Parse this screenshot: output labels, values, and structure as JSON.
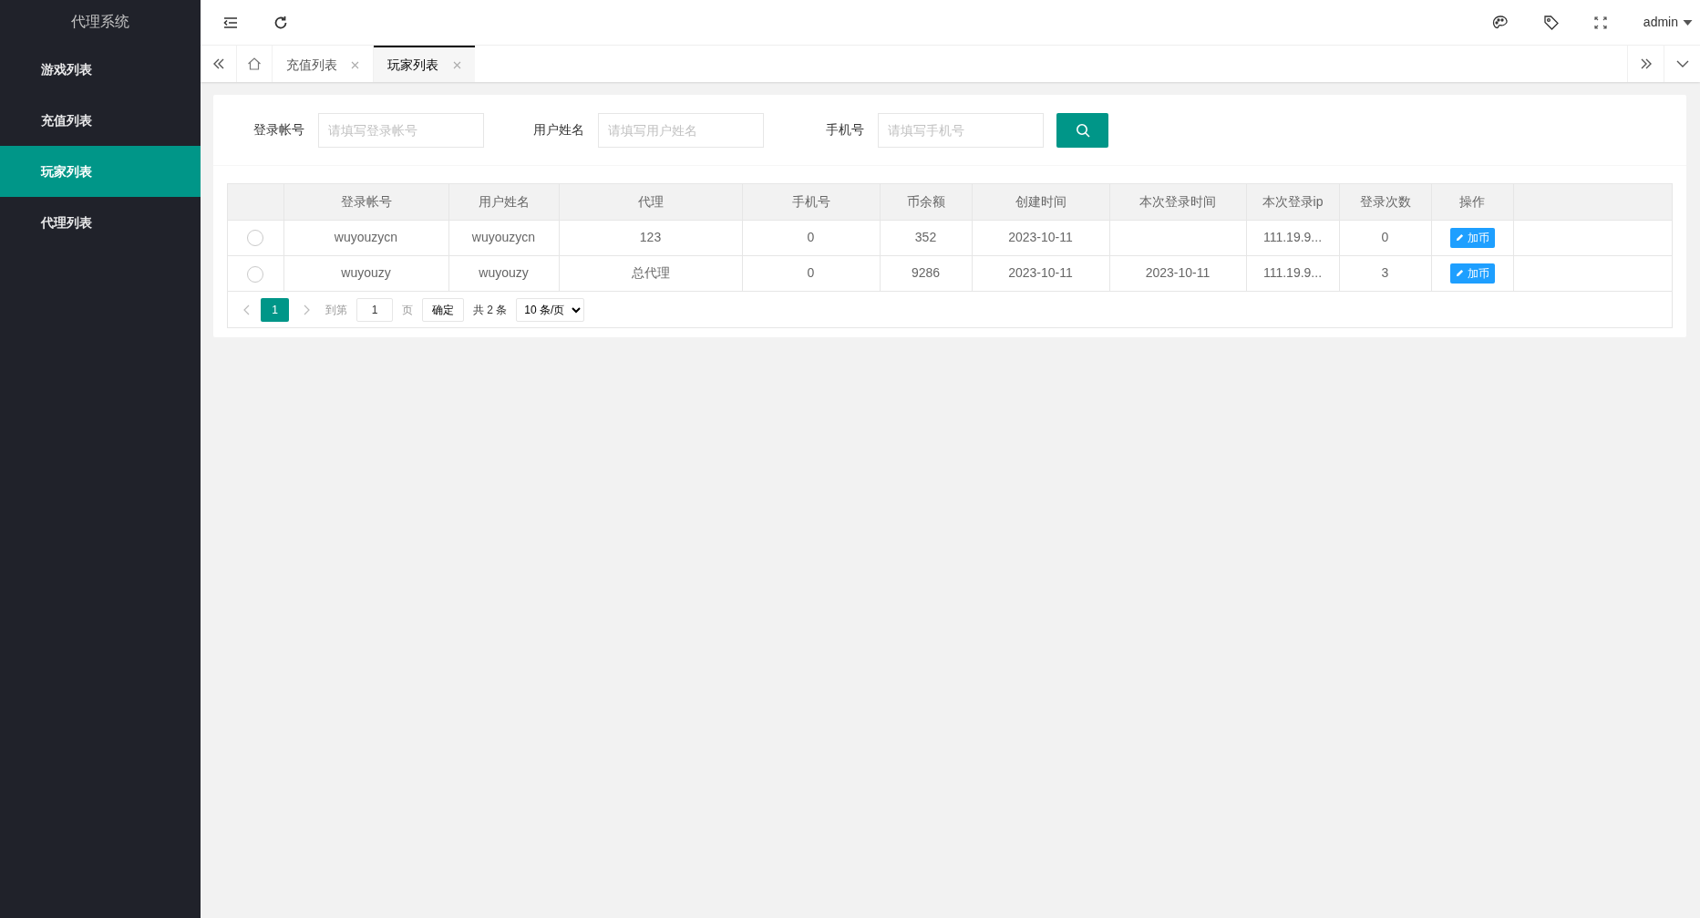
{
  "sidebar": {
    "title": "代理系统",
    "items": [
      {
        "label": "游戏列表",
        "selected": false
      },
      {
        "label": "充值列表",
        "selected": false
      },
      {
        "label": "玩家列表",
        "selected": true
      },
      {
        "label": "代理列表",
        "selected": false
      }
    ]
  },
  "header": {
    "user": "admin"
  },
  "tabs": [
    {
      "label": "充值列表",
      "selected": false
    },
    {
      "label": "玩家列表",
      "selected": true
    }
  ],
  "search": {
    "fields": [
      {
        "label": "登录帐号",
        "placeholder": "请填写登录帐号"
      },
      {
        "label": "用户姓名",
        "placeholder": "请填写用户姓名"
      },
      {
        "label": "手机号",
        "placeholder": "请填写手机号"
      }
    ]
  },
  "table": {
    "columns": [
      "登录帐号",
      "用户姓名",
      "代理",
      "手机号",
      "币余额",
      "创建时间",
      "本次登录时间",
      "本次登录ip",
      "登录次数",
      "操作"
    ],
    "rows": [
      {
        "selected": false,
        "cells": [
          "wuyouzycn",
          "wuyouzycn",
          "123",
          "0",
          "352",
          "2023-10-11",
          "",
          "111.19.9...",
          "0"
        ],
        "action": "加币"
      },
      {
        "selected": false,
        "cells": [
          "wuyouzy",
          "wuyouzy",
          "总代理",
          "0",
          "9286",
          "2023-10-11",
          "2023-10-11",
          "111.19.9...",
          "3"
        ],
        "action": "加币"
      }
    ]
  },
  "pagination": {
    "pages": [
      {
        "label": "1",
        "selected": true
      }
    ],
    "goto_label": "到第",
    "page_input": "1",
    "page_unit": "页",
    "confirm": "确定",
    "total": "共 2 条",
    "page_size": "10 条/页"
  }
}
